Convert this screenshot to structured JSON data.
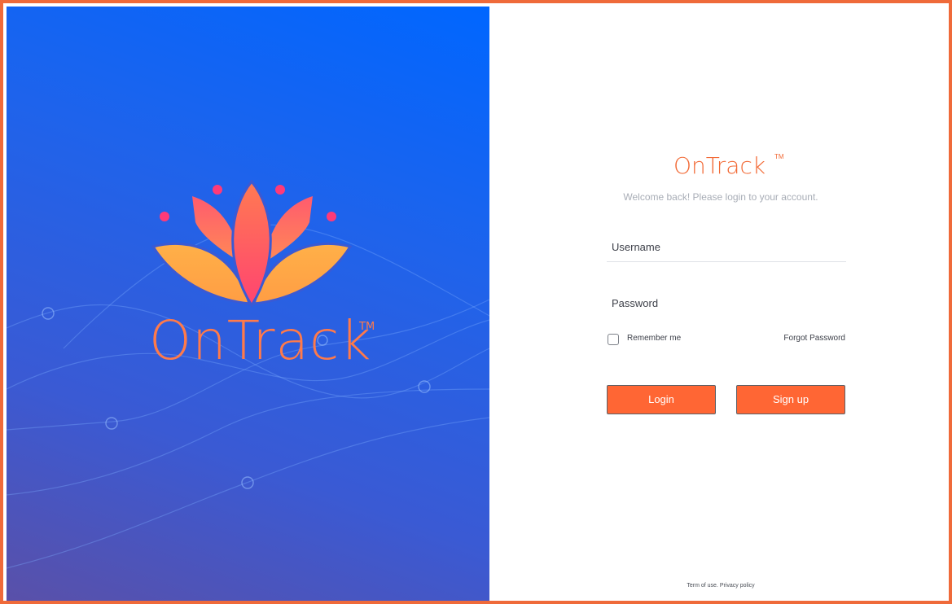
{
  "brand": {
    "name": "OnTrack",
    "trademark": "TM",
    "logo_icon": "lotus-icon",
    "colors": {
      "brand_orange": "#ff7a4a",
      "panel_blue": "#0066ff",
      "button_orange": "#ff6634"
    }
  },
  "login_form": {
    "title": "OnTrack",
    "trademark": "TM",
    "subtitle": "Welcome back! Please login to your account.",
    "username_label": "Username",
    "username_value": "",
    "password_label": "Password",
    "password_value": "",
    "remember_label": "Remember me",
    "remember_checked": false,
    "forgot_label": "Forgot Password",
    "login_label": "Login",
    "signup_label": "Sign up"
  },
  "footer": {
    "terms_label": "Term of use.",
    "privacy_label": "Privacy policy"
  }
}
